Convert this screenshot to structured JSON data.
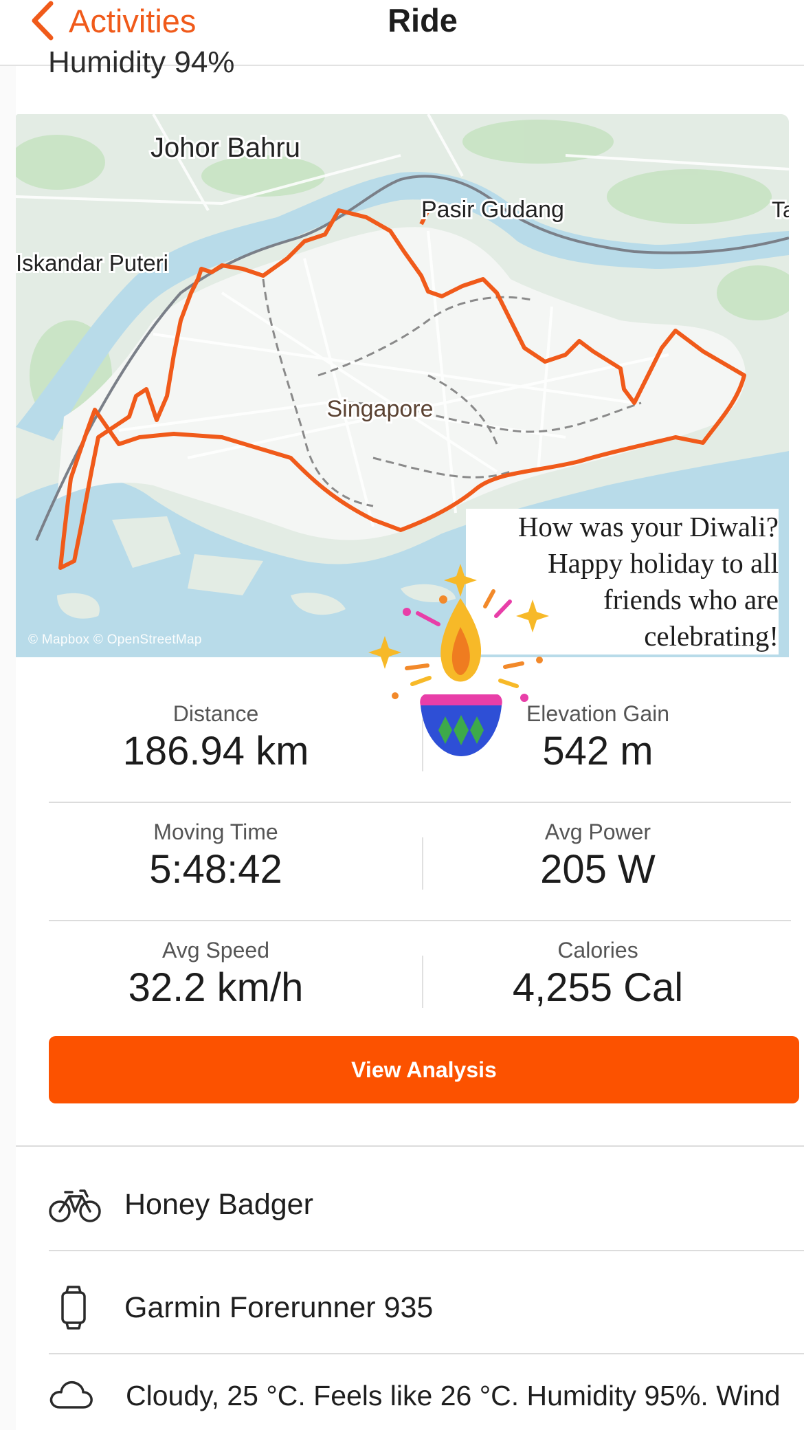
{
  "nav": {
    "back_label": "Activities",
    "title": "Ride",
    "peek_text": "Humidity 94%"
  },
  "map": {
    "labels": {
      "johor": "Johor Bahru",
      "pasir": "Pasir Gudang",
      "iskandar": "Iskandar Puteri",
      "singapore": "Singapore",
      "edge": "Ta"
    },
    "attribution": "© Mapbox © OpenStreetMap",
    "route_color": "#f05a1a"
  },
  "sticker": {
    "lines": [
      "How was your Diwali?",
      "Happy holiday to all",
      "friends who are",
      "celebrating!"
    ]
  },
  "stats": [
    {
      "label": "Distance",
      "value": "186.94 km"
    },
    {
      "label": "Elevation Gain",
      "value": "542 m"
    },
    {
      "label": "Moving Time",
      "value": "5:48:42"
    },
    {
      "label": "Avg Power",
      "value": "205 W"
    },
    {
      "label": "Avg Speed",
      "value": "32.2 km/h"
    },
    {
      "label": "Calories",
      "value": "4,255 Cal"
    }
  ],
  "cta": {
    "label": "View Analysis",
    "color": "#fc5200"
  },
  "gear": [
    {
      "icon": "bike-icon",
      "label": "Honey Badger"
    },
    {
      "icon": "watch-icon",
      "label": "Garmin Forerunner 935"
    }
  ],
  "weather": {
    "icon": "cloud-icon",
    "text": "Cloudy, 25 °C. Feels like 26 °C. Humidity 95%. Wind"
  }
}
